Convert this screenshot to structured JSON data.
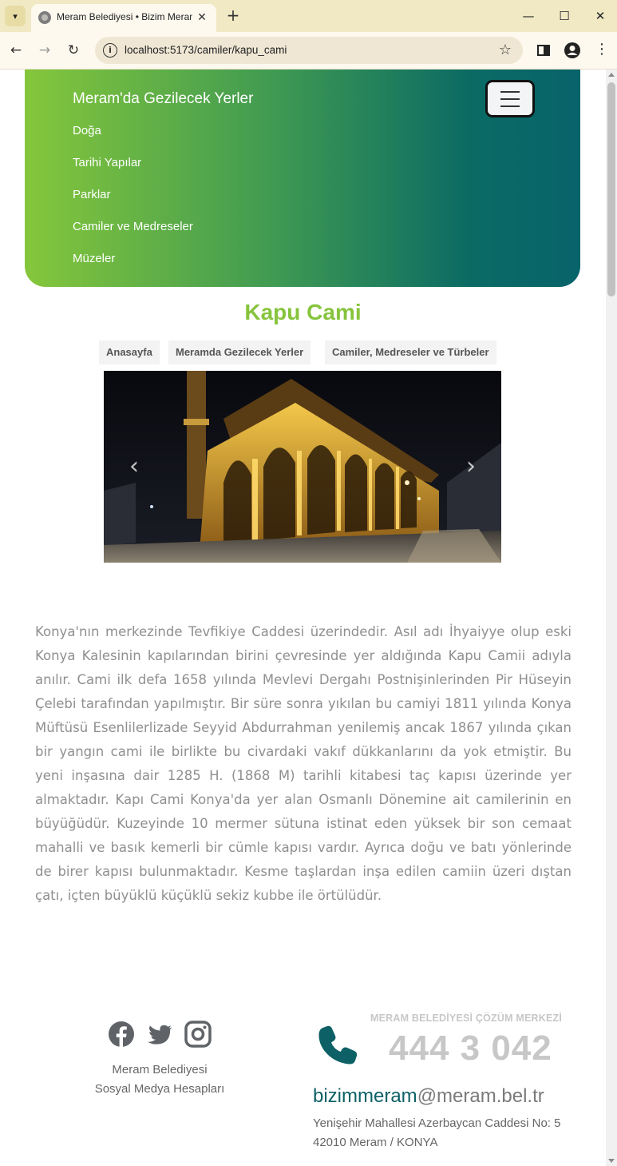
{
  "browser": {
    "tab_title": "Meram Belediyesi • Bizim Meram",
    "url": "localhost:5173/camiler/kapu_cami"
  },
  "nav": {
    "brand": "Meram'da Gezilecek Yerler",
    "links": [
      "Doğa",
      "Tarihi Yapılar",
      "Parklar",
      "Camiler ve Medreseler",
      "Müzeler"
    ]
  },
  "page": {
    "title": "Kapu Cami",
    "breadcrumbs": [
      "Anasayfa",
      "Meramda Gezilecek Yerler",
      "Camiler, Medreseler ve Türbeler"
    ],
    "body": "Konya'nın merkezinde Tevfikiye Caddesi üzerindedir. Asıl adı İhyaiyye olup eski Konya Kalesinin kapılarından birini çevresinde yer aldığında Kapu Camii adıyla anılır. Cami ilk defa 1658 yılında Mevlevi Dergahı Postnişinlerinden Pir Hüseyin Çelebi tarafından yapılmıştır. Bir süre sonra yıkılan bu camiyi 1811 yılında Konya Müftüsü Esenlilerlizade Seyyid Abdurrahman yenilemiş ancak 1867 yılında çıkan bir yangın cami ile birlikte bu civardaki vakıf dükkanlarını da yok etmiştir. Bu yeni inşasına dair 1285 H. (1868 M) tarihli kitabesi taç kapısı üzerinde yer almaktadır. Kapı Cami Konya'da yer alan Osmanlı Dönemine ait camilerinin en büyüğüdür. Kuzeyinde 10 mermer sütuna istinat eden yüksek bir son cemaat mahalli ve basık kemerli bir cümle kapısı vardır. Ayrıca doğu ve batı yönlerinde de birer kapısı bulunmaktadır. Kesme taşlardan inşa edilen camiin üzeri dıştan çatı, içten büyüklü küçüklü sekiz kubbe ile örtülüdür."
  },
  "footer": {
    "social_caption_1": "Meram Belediyesi",
    "social_caption_2": "Sosyal Medya Hesapları",
    "help_label": "MERAM BELEDİYESİ ÇÖZÜM MERKEZİ",
    "help_phone": "444 3 042",
    "email_user": "bizimmeram",
    "email_domain": "@meram.bel.tr",
    "address_line_1": "Yenişehir Mahallesi Azerbaycan Caddesi No: 5",
    "address_line_2": "42010 Meram / KONYA"
  },
  "icons": {
    "social": [
      "facebook-icon",
      "twitter-icon",
      "instagram-icon"
    ],
    "phone": "phone-icon"
  },
  "colors": {
    "accent_green": "#86c43c",
    "nav_gradient_start": "#85c73b",
    "nav_gradient_end": "#07636a",
    "phone_teal": "#0d6166"
  }
}
